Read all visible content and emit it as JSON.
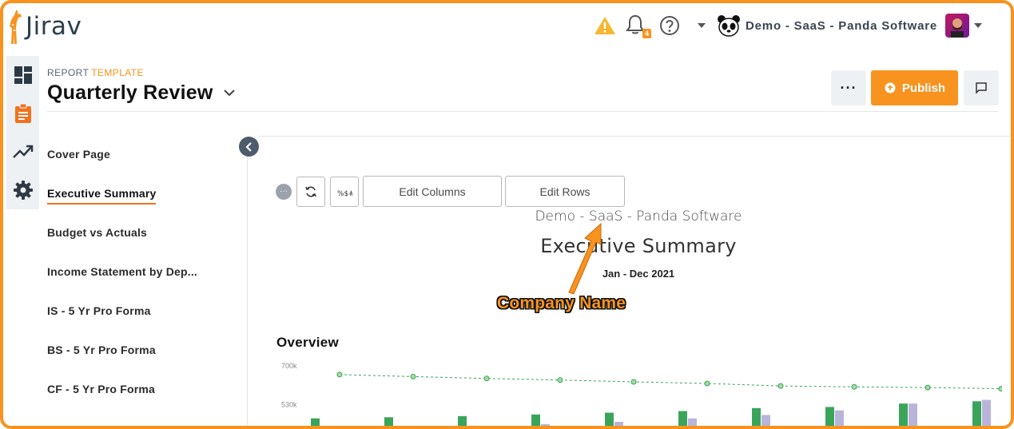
{
  "app": {
    "logo_text": "Jirav",
    "notifications_count": "4",
    "company_selector": "Demo - SaaS - Panda Software"
  },
  "header": {
    "kicker": "REPORT",
    "kicker_accent": "TEMPLATE",
    "title": "Quarterly Review",
    "more_label": "···",
    "publish_label": "Publish"
  },
  "sidebar": {
    "items": [
      {
        "label": "Cover Page",
        "active": false
      },
      {
        "label": "Executive Summary",
        "active": true
      },
      {
        "label": "Budget vs Actuals",
        "active": false
      },
      {
        "label": "Income Statement by Dep...",
        "active": false
      },
      {
        "label": "IS - 5 Yr Pro Forma",
        "active": false
      },
      {
        "label": "BS - 5 Yr Pro Forma",
        "active": false
      },
      {
        "label": "CF - 5 Yr Pro Forma",
        "active": false
      }
    ]
  },
  "toolbar": {
    "dots_label": "···",
    "edit_columns_label": "Edit Columns",
    "edit_rows_label": "Edit Rows",
    "format_label": "%$#"
  },
  "report": {
    "company": "Demo - SaaS - Panda Software",
    "title": "Executive Summary",
    "period": "Jan - Dec 2021"
  },
  "annotation": {
    "label": "Company Name"
  },
  "overview": {
    "title": "Overview"
  },
  "colors": {
    "accent": "#f7931e",
    "green": "#3aa55a",
    "lavender": "#b9b4da",
    "rail_bg": "#eef1f4"
  },
  "chart_data": {
    "type": "bar",
    "y_ticks": [
      "700k",
      "530k"
    ],
    "y_tick_values": [
      700000,
      530000
    ],
    "ylim": [
      420000,
      700000
    ],
    "series": [
      {
        "kind": "bar",
        "values": [
          470000,
          475000,
          480000,
          487000,
          495000,
          502000,
          515000,
          520000,
          535000,
          545000
        ]
      },
      {
        "kind": "bar",
        "values": [
          420000,
          425000,
          438000,
          445000,
          455000,
          470000,
          485000,
          505000,
          535000,
          551000
        ]
      },
      {
        "kind": "line",
        "values": [
          662000,
          653000,
          645000,
          638000,
          630000,
          623000,
          612000,
          608000,
          605000,
          600000
        ]
      }
    ],
    "grid": false,
    "legend": "none"
  }
}
